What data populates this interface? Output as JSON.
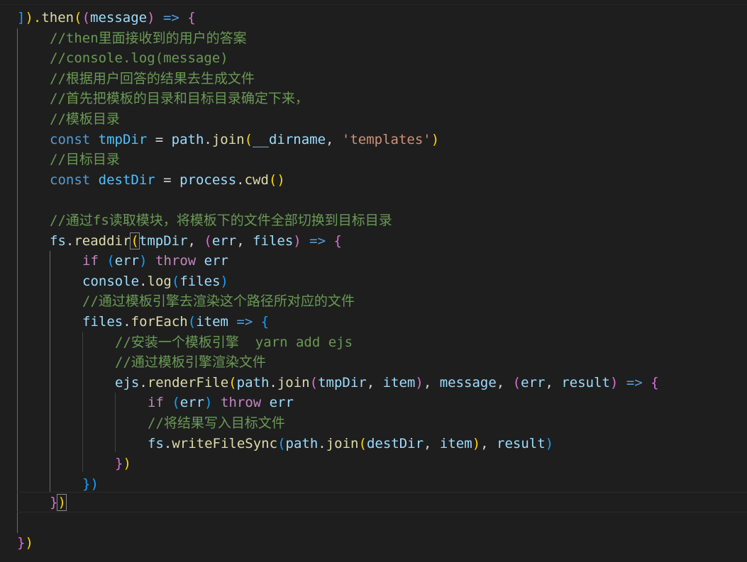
{
  "window": {
    "app": "code-editor",
    "theme": "dark"
  },
  "code": {
    "line1": {
      "bracket_close": "]",
      "dot": ").",
      "then": "then",
      "open_paren": "(",
      "param_open": "(",
      "param": "message",
      "param_close": ")",
      "arrow": " => ",
      "brace": "{"
    },
    "line2": {
      "comment": "//then里面接收到的用户的答案"
    },
    "line3": {
      "comment": "//console.log(message)"
    },
    "line4": {
      "comment": "//根据用户回答的结果去生成文件"
    },
    "line5": {
      "comment": "//首先把模板的目录和目标目录确定下来，"
    },
    "line6": {
      "comment": "//模板目录"
    },
    "line7": {
      "const": "const",
      "name": "tmpDir",
      "eq": " = ",
      "obj": "path",
      "dot": ".",
      "method": "join",
      "open": "(",
      "arg1": "__dirname",
      "comma": ", ",
      "arg2": "'templates'",
      "close": ")"
    },
    "line8": {
      "comment": "//目标目录"
    },
    "line9": {
      "const": "const",
      "name": "destDir",
      "eq": " = ",
      "obj": "process",
      "dot": ".",
      "method": "cwd",
      "parens": "()"
    },
    "line11": {
      "comment": "//通过fs读取模块，将模板下的文件全部切换到目标目录"
    },
    "line12": {
      "obj": "fs",
      "dot": ".",
      "method": "readdir",
      "open": "(",
      "arg": "tmpDir",
      "comma": ", ",
      "popen": "(",
      "p1": "err",
      "pcomma": ", ",
      "p2": "files",
      "pclose": ")",
      "arrow": " => ",
      "brace": "{"
    },
    "line13": {
      "if": "if",
      "open": " (",
      "cond": "err",
      "close": ") ",
      "throw": "throw",
      "val": " err"
    },
    "line14": {
      "obj": "console",
      "dot": ".",
      "method": "log",
      "open": "(",
      "arg": "files",
      "close": ")"
    },
    "line15": {
      "comment": "//通过模板引擎去渲染这个路径所对应的文件"
    },
    "line16": {
      "obj": "files",
      "dot": ".",
      "method": "forEach",
      "open": "(",
      "param": "item",
      "arrow": " => ",
      "brace": "{"
    },
    "line17": {
      "comment": "//安装一个模板引擎  yarn add ejs"
    },
    "line18": {
      "comment": "//通过模板引擎渲染文件"
    },
    "line19": {
      "obj": "ejs",
      "dot": ".",
      "method": "renderFile",
      "open": "(",
      "obj2": "path",
      "dot2": ".",
      "method2": "join",
      "open2": "(",
      "a1": "tmpDir",
      "c1": ", ",
      "a2": "item",
      "close2": ")",
      "c2": ", ",
      "a3": "message",
      "c3": ", ",
      "popen": "(",
      "p1": "err",
      "pc": ", ",
      "p2": "result",
      "pclose": ")",
      "arrow": " => ",
      "brace": "{"
    },
    "line20": {
      "if": "if",
      "open": " (",
      "cond": "err",
      "close": ") ",
      "throw": "throw",
      "val": " err"
    },
    "line21": {
      "comment": "//将结果写入目标文件"
    },
    "line22": {
      "obj": "fs",
      "dot": ".",
      "method": "writeFileSync",
      "open": "(",
      "obj2": "path",
      "dot2": ".",
      "method2": "join",
      "open2": "(",
      "a1": "destDir",
      "c1": ", ",
      "a2": "item",
      "close2": ")",
      "c2": ", ",
      "a3": "result",
      "close": ")"
    },
    "line23": {
      "brace": "}",
      "paren": ")"
    },
    "line24": {
      "brace": "}",
      "paren": ")"
    },
    "line25": {
      "brace": "}",
      "paren": ")"
    },
    "line27": {
      "brace": "}",
      "paren": ")"
    }
  },
  "colors": {
    "background": "#1e1e1e",
    "keyword": "#569cd6",
    "control": "#c586c0",
    "function": "#dcdcaa",
    "variable": "#9cdcfe",
    "constant": "#4fc1ff",
    "string": "#ce9178",
    "comment": "#6a9955",
    "bracket_gold": "#ffd700",
    "bracket_orchid": "#da70d6",
    "bracket_blue": "#179fff"
  }
}
